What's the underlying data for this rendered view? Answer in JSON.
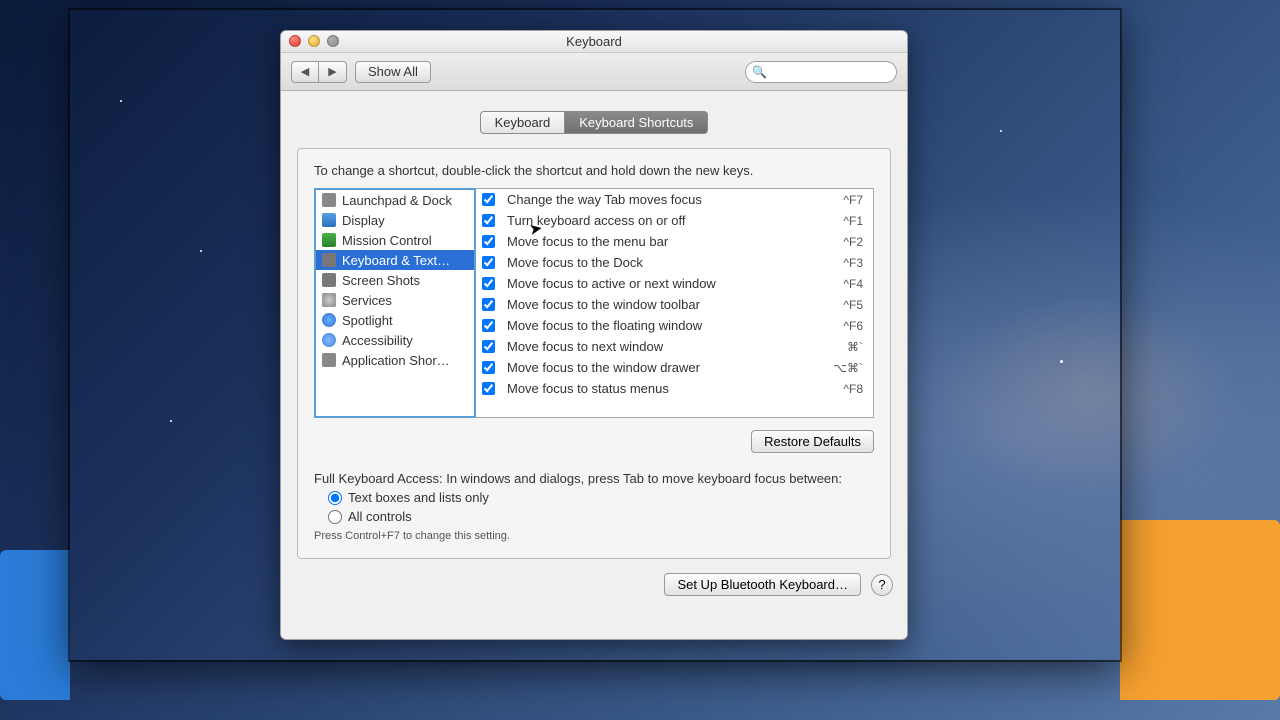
{
  "window": {
    "title": "Keyboard"
  },
  "toolbar": {
    "back_icon": "◀",
    "forward_icon": "▶",
    "show_all": "Show All",
    "search_placeholder": ""
  },
  "tabs": {
    "keyboard": "Keyboard",
    "shortcuts": "Keyboard Shortcuts"
  },
  "instruction": "To change a shortcut, double-click the shortcut and hold down the new keys.",
  "categories": [
    {
      "label": "Launchpad & Dock",
      "icon": "ic-generic",
      "selected": false
    },
    {
      "label": "Display",
      "icon": "ic-display",
      "selected": false
    },
    {
      "label": "Mission Control",
      "icon": "ic-mission",
      "selected": false
    },
    {
      "label": "Keyboard & Text…",
      "icon": "ic-kb",
      "selected": true
    },
    {
      "label": "Screen Shots",
      "icon": "ic-camera",
      "selected": false
    },
    {
      "label": "Services",
      "icon": "ic-gear",
      "selected": false
    },
    {
      "label": "Spotlight",
      "icon": "ic-spot",
      "selected": false
    },
    {
      "label": "Accessibility",
      "icon": "ic-access",
      "selected": false
    },
    {
      "label": "Application Shor…",
      "icon": "ic-generic",
      "selected": false
    }
  ],
  "shortcuts": [
    {
      "enabled": true,
      "label": "Change the way Tab moves focus",
      "key": "^F7"
    },
    {
      "enabled": true,
      "label": "Turn keyboard access on or off",
      "key": "^F1"
    },
    {
      "enabled": true,
      "label": "Move focus to the menu bar",
      "key": "^F2"
    },
    {
      "enabled": true,
      "label": "Move focus to the Dock",
      "key": "^F3"
    },
    {
      "enabled": true,
      "label": "Move focus to active or next window",
      "key": "^F4"
    },
    {
      "enabled": true,
      "label": "Move focus to the window toolbar",
      "key": "^F5"
    },
    {
      "enabled": true,
      "label": "Move focus to the floating window",
      "key": "^F6"
    },
    {
      "enabled": true,
      "label": "Move focus to next window",
      "key": "⌘`"
    },
    {
      "enabled": true,
      "label": "Move focus to the window drawer",
      "key": "⌥⌘`"
    },
    {
      "enabled": true,
      "label": "Move focus to status menus",
      "key": "^F8"
    }
  ],
  "restore": "Restore Defaults",
  "fka": {
    "intro": "Full Keyboard Access: In windows and dialogs, press Tab to move keyboard focus between:",
    "opt1": "Text boxes and lists only",
    "opt2": "All controls",
    "hint": "Press Control+F7 to change this setting."
  },
  "footer": {
    "bluetooth": "Set Up Bluetooth Keyboard…",
    "help": "?"
  }
}
